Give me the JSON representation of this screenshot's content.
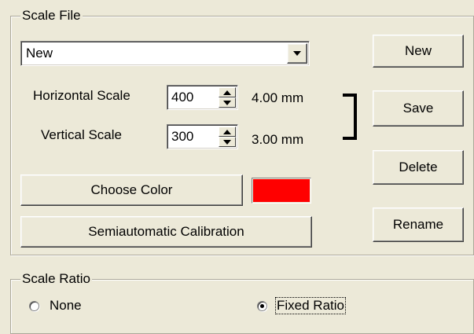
{
  "scale_file": {
    "legend": "Scale File",
    "selected": "New",
    "horizontal_label": "Horizontal Scale",
    "horizontal_value": "400",
    "horizontal_mm": "4.00 mm",
    "vertical_label": "Vertical Scale",
    "vertical_value": "300",
    "vertical_mm": "3.00 mm",
    "choose_color_label": "Choose Color",
    "color_swatch": "#ff0000",
    "calibration_label": "Semiautomatic Calibration"
  },
  "buttons": {
    "new_label": "New",
    "save_label": "Save",
    "delete_label": "Delete",
    "rename_label": "Rename"
  },
  "scale_ratio": {
    "legend": "Scale Ratio",
    "options": [
      "None",
      "Fixed Ratio"
    ],
    "selected": "Fixed Ratio"
  }
}
